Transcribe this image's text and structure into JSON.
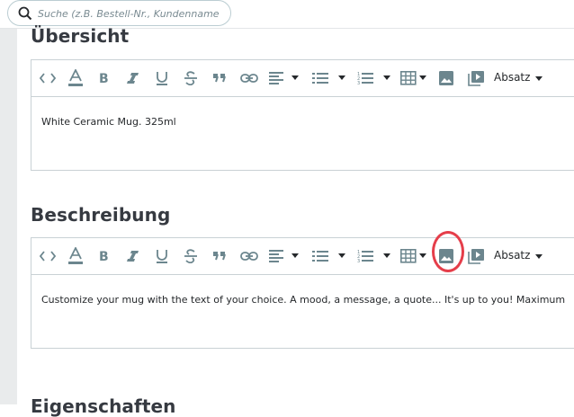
{
  "search": {
    "placeholder": "Suche (z.B. Bestell-Nr., Kundenname ..."
  },
  "sections": {
    "uebersicht": {
      "title": "Übersicht",
      "content": "White Ceramic Mug. 325ml"
    },
    "beschreibung": {
      "title": "Beschreibung",
      "content": "Customize your mug with the text of your choice. A mood, a message, a quote... It's up to you! Maximum"
    },
    "next": {
      "title": "Eigenschaften"
    }
  },
  "toolbar": {
    "format_label": "Absatz"
  },
  "colors": {
    "accent": "#e53e4a",
    "icon": "#6c868e",
    "border": "#c9d1d5"
  }
}
